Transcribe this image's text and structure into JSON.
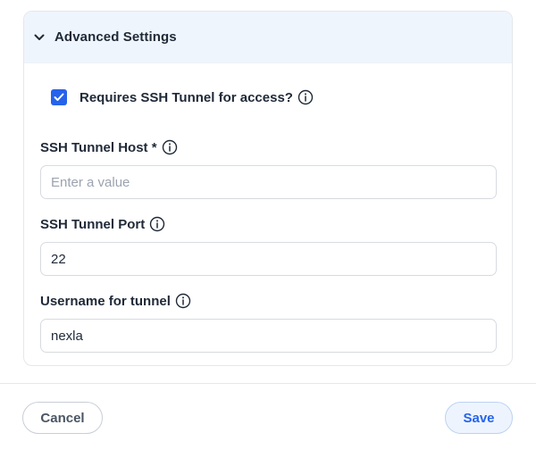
{
  "panel": {
    "title": "Advanced Settings",
    "expanded": true
  },
  "ssh_checkbox": {
    "label": "Requires SSH Tunnel for access?",
    "checked": true
  },
  "fields": {
    "host": {
      "label": "SSH Tunnel Host *",
      "value": "",
      "placeholder": "Enter a value"
    },
    "port": {
      "label": "SSH Tunnel Port",
      "value": "22",
      "placeholder": ""
    },
    "username": {
      "label": "Username for tunnel",
      "value": "nexla",
      "placeholder": ""
    }
  },
  "footer": {
    "cancel_label": "Cancel",
    "save_label": "Save"
  },
  "colors": {
    "accent": "#2563eb",
    "header_bg": "#eff5fc",
    "save_bg": "#eef4fd"
  },
  "icons": {
    "chevron": "chevron-down-icon",
    "info": "info-icon",
    "check": "checkmark-icon"
  }
}
